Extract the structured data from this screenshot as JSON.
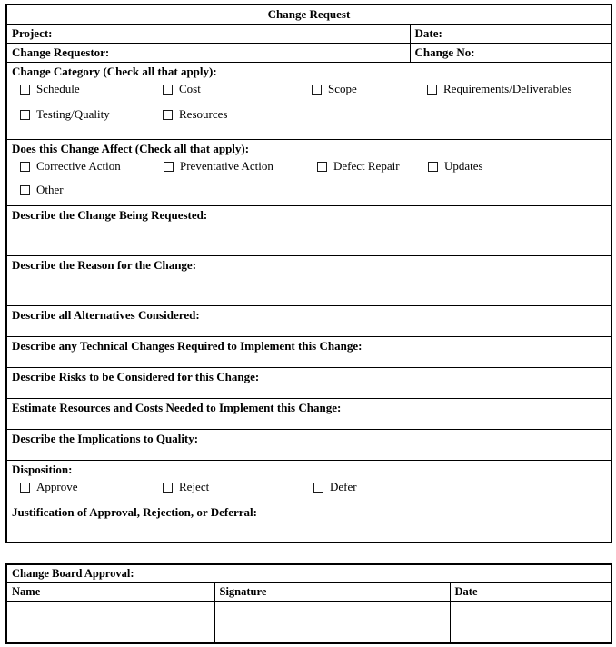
{
  "document": {
    "title": "Change Request"
  },
  "header_fields": {
    "project_label": "Project:",
    "date_label": "Date:",
    "requestor_label": "Change Requestor:",
    "change_no_label": "Change No:"
  },
  "change_category": {
    "heading": "Change Category (Check all that apply):",
    "options_row1": [
      {
        "label": "Schedule",
        "checked": false
      },
      {
        "label": "Cost",
        "checked": false
      },
      {
        "label": "Scope",
        "checked": false
      },
      {
        "label": "Requirements/Deliverables",
        "checked": false
      }
    ],
    "options_row2": [
      {
        "label": "Testing/Quality",
        "checked": false
      },
      {
        "label": "Resources",
        "checked": false
      }
    ]
  },
  "change_affect": {
    "heading": "Does this Change Affect (Check all that apply):",
    "options_row1": [
      {
        "label": "Corrective Action",
        "checked": false
      },
      {
        "label": "Preventative Action",
        "checked": false
      },
      {
        "label": "Defect Repair",
        "checked": false
      },
      {
        "label": "Updates",
        "checked": false
      }
    ],
    "options_row2": [
      {
        "label": "Other",
        "checked": false
      }
    ]
  },
  "sections": [
    {
      "label": "Describe the Change Being Requested:",
      "value": ""
    },
    {
      "label": "Describe the Reason for the Change:",
      "value": ""
    },
    {
      "label": "Describe all Alternatives Considered:",
      "value": ""
    },
    {
      "label": "Describe any Technical Changes Required to Implement this Change:",
      "value": ""
    },
    {
      "label": "Describe Risks to be Considered for this Change:",
      "value": ""
    },
    {
      "label": "Estimate Resources and Costs Needed to Implement this Change:",
      "value": ""
    },
    {
      "label": "Describe the Implications to Quality:",
      "value": ""
    }
  ],
  "disposition": {
    "heading": "Disposition:",
    "options": [
      {
        "label": "Approve",
        "checked": false
      },
      {
        "label": "Reject",
        "checked": false
      },
      {
        "label": "Defer",
        "checked": false
      }
    ],
    "justification_label": "Justification of Approval, Rejection, or Deferral:",
    "justification_value": ""
  },
  "change_board_approval": {
    "heading": "Change Board Approval:",
    "columns": [
      "Name",
      "Signature",
      "Date"
    ],
    "rows": [
      {
        "name": "",
        "signature": "",
        "date": ""
      },
      {
        "name": "",
        "signature": "",
        "date": ""
      }
    ]
  },
  "colors": {
    "border": "#000000",
    "background": "#ffffff",
    "text": "#000000"
  }
}
